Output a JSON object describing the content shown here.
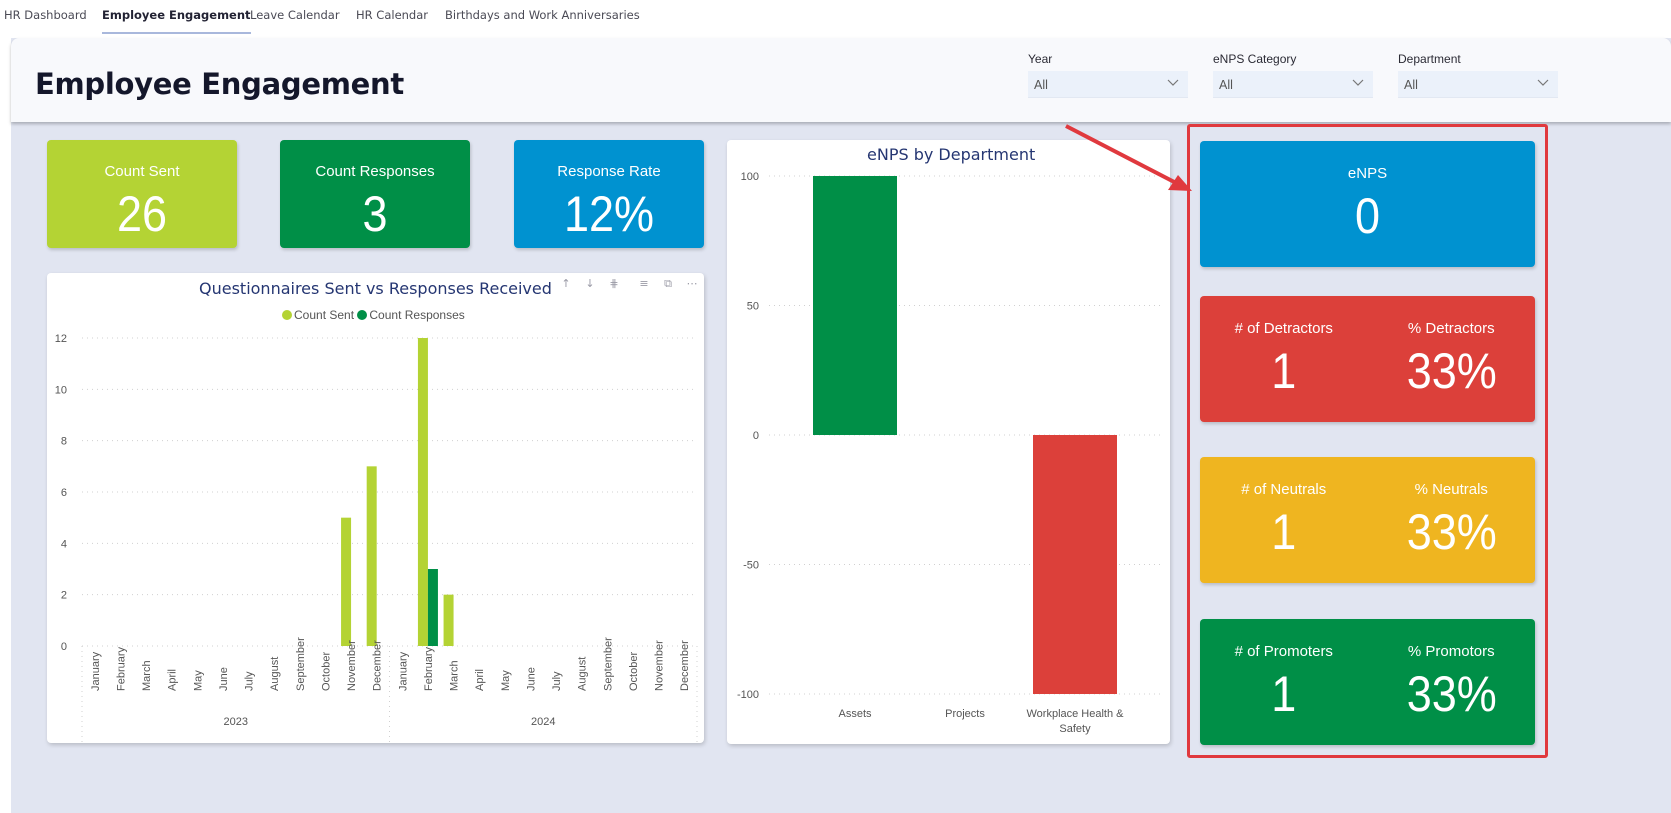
{
  "tabs": [
    {
      "label": "HR Dashboard",
      "active": false
    },
    {
      "label": "Employee Engagement",
      "active": true
    },
    {
      "label": "Leave Calendar",
      "active": false
    },
    {
      "label": "HR Calendar",
      "active": false
    },
    {
      "label": "Birthdays and Work Anniversaries",
      "active": false
    }
  ],
  "header": {
    "title": "Employee Engagement",
    "slicers": [
      {
        "label": "Year",
        "value": "All"
      },
      {
        "label": "eNPS Category",
        "value": "All"
      },
      {
        "label": "Department",
        "value": "All"
      }
    ]
  },
  "kpis": [
    {
      "label": "Count Sent",
      "value": "26",
      "color": "#b4d334"
    },
    {
      "label": "Count Responses",
      "value": "3",
      "color": "#008f47"
    },
    {
      "label": "Response Rate",
      "value": "12%",
      "color": "#0092d0"
    }
  ],
  "enps_panel": {
    "enps": {
      "label": "eNPS",
      "value": "0",
      "color": "#0092d0"
    },
    "groups": [
      {
        "count_label": "# of Detractors",
        "count": "1",
        "pct_label": "% Detractors",
        "pct": "33%",
        "color": "#dc403a"
      },
      {
        "count_label": "# of Neutrals",
        "count": "1",
        "pct_label": "% Neutrals",
        "pct": "33%",
        "color": "#efb520"
      },
      {
        "count_label": "# of Promoters",
        "count": "1",
        "pct_label": "% Promotors",
        "pct": "33%",
        "color": "#008f47"
      }
    ]
  },
  "chart_data": [
    {
      "type": "bar",
      "title": "Questionnaires Sent vs Responses Received",
      "legend": [
        "Count Sent",
        "Count Responses"
      ],
      "legend_position": "top-center",
      "colors": {
        "Count Sent": "#b4d334",
        "Count Responses": "#008f47"
      },
      "ylim": [
        0,
        12
      ],
      "yticks": [
        0,
        2,
        4,
        6,
        8,
        10,
        12
      ],
      "grid": true,
      "groups": [
        {
          "year": "2023",
          "months": [
            "January",
            "February",
            "March",
            "April",
            "May",
            "June",
            "July",
            "August",
            "September",
            "October",
            "November",
            "December"
          ]
        },
        {
          "year": "2024",
          "months": [
            "January",
            "February",
            "March",
            "April",
            "May",
            "June",
            "July",
            "August",
            "September",
            "October",
            "November",
            "December"
          ]
        }
      ],
      "series": [
        {
          "name": "Count Sent",
          "values": [
            0,
            0,
            0,
            0,
            0,
            0,
            0,
            0,
            0,
            0,
            5,
            7,
            0,
            12,
            2,
            0,
            0,
            0,
            0,
            0,
            0,
            0,
            0,
            0
          ]
        },
        {
          "name": "Count Responses",
          "values": [
            0,
            0,
            0,
            0,
            0,
            0,
            0,
            0,
            0,
            0,
            0,
            0,
            0,
            3,
            0,
            0,
            0,
            0,
            0,
            0,
            0,
            0,
            0,
            0
          ]
        }
      ]
    },
    {
      "type": "bar",
      "title": "eNPS by Department",
      "categories": [
        "Assets",
        "Projects",
        "Workplace Health & Safety"
      ],
      "values": [
        100,
        0,
        -100
      ],
      "colors": [
        "#008f47",
        "#008f47",
        "#dc403a"
      ],
      "ylim": [
        -100,
        100
      ],
      "yticks": [
        -100,
        -50,
        0,
        50,
        100
      ],
      "grid": true
    }
  ],
  "visual_header_icons": [
    "arrow-up-icon",
    "arrow-down-icon",
    "expand-hierarchy-icon",
    "filter-icon",
    "focus-mode-icon",
    "more-options-icon"
  ]
}
